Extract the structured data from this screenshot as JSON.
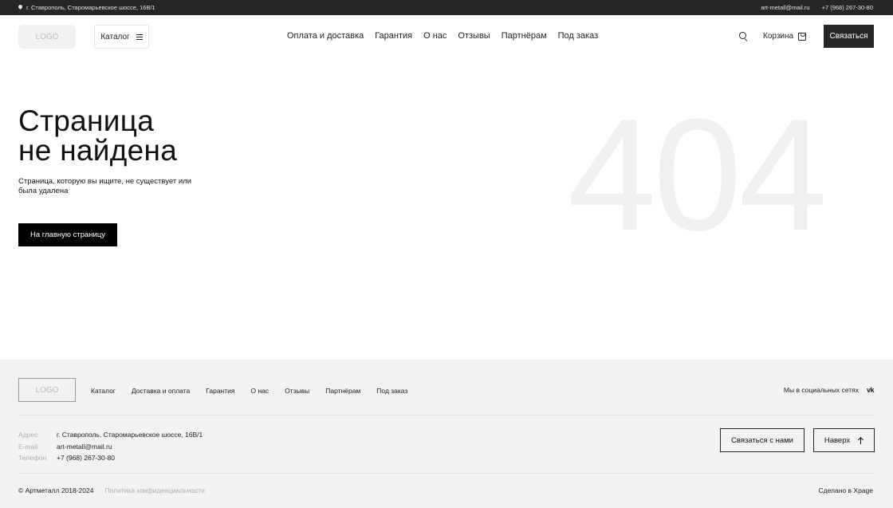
{
  "topbar": {
    "address": "г. Ставрополь, Старомарьевское шоссе, 16В/1",
    "email": "art-metall@mail.ru",
    "phone": "+7 (968) 267-30-80",
    "pin_icon": "map-pin-icon"
  },
  "header": {
    "logo": "LOGO",
    "catalog_label": "Каталог",
    "nav": [
      "Оплата и доставка",
      "Гарантия",
      "О нас",
      "Отзывы",
      "Партнёрам",
      "Под заказ"
    ],
    "cart_label": "Корзина",
    "contact_button": "Связаться"
  },
  "main": {
    "title_line1": "Страница",
    "title_line2": "не найдена",
    "subtitle": "Страница, которую вы ищите, не существует или была удалена",
    "home_button": "На главную страницу",
    "error_code": "404"
  },
  "footer": {
    "logo": "LOGO",
    "nav": [
      "Каталог",
      "Доставка и оплата",
      "Гарантия",
      "О нас",
      "Отзывы",
      "Партнёрам",
      "Под заказ"
    ],
    "social_label": "Мы в социальных сетях",
    "vk_icon": "vk",
    "contacts": [
      {
        "label": "Адрес",
        "value": "г. Ставрополь, Старомарьевское шоссе, 16В/1"
      },
      {
        "label": "E-mail",
        "value": "art-metall@mail.ru"
      },
      {
        "label": "Телефон",
        "value": "+7 (968) 267-30-80"
      }
    ],
    "contact_button": "Связаться с нами",
    "up_button": "Наверх",
    "copyright": "© Артметалл 2018-2024",
    "privacy": "Политика конфиденциальности",
    "made_by": "Сделано в Xpage"
  },
  "colors": {
    "topbar_bg": "#262626",
    "footer_bg": "#f2f2f2",
    "primary_button": "#000000",
    "watermark": "#f0f0f0"
  }
}
